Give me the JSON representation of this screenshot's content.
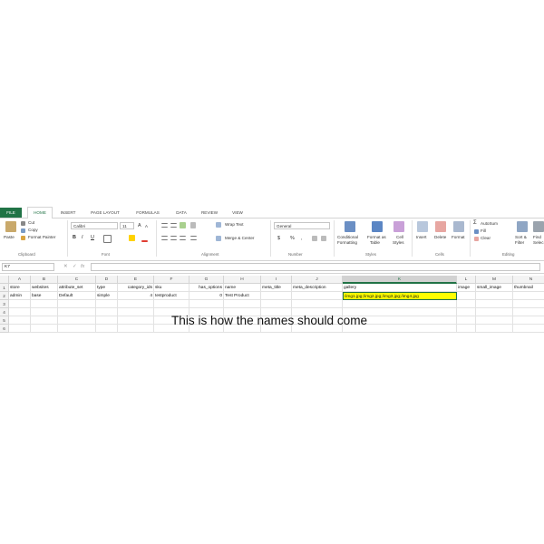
{
  "tabs": [
    "FILE",
    "HOME",
    "INSERT",
    "PAGE LAYOUT",
    "FORMULAS",
    "DATA",
    "REVIEW",
    "VIEW"
  ],
  "ribbon": {
    "clipboard": {
      "paste": "Paste",
      "cut": "Cut",
      "copy": "Copy",
      "format_painter": "Format Painter",
      "label": "Clipboard"
    },
    "font": {
      "name": "Calibri",
      "size": "11",
      "bold": "B",
      "italic": "I",
      "underline": "U",
      "grow": "A",
      "shrink": "A",
      "label": "Font"
    },
    "alignment": {
      "wrap": "Wrap Text",
      "merge": "Merge & Center",
      "label": "Alignment"
    },
    "number": {
      "format": "General",
      "currency": "$",
      "percent": "%",
      "comma": ",",
      "label": "Number"
    },
    "styles": {
      "conditional1": "Conditional",
      "conditional2": "Formatting",
      "table1": "Format as",
      "table2": "Table",
      "cell1": "Cell",
      "cell2": "Styles",
      "label": "Styles"
    },
    "cells": {
      "insert": "Insert",
      "delete": "Delete",
      "format": "Format",
      "label": "Cells"
    },
    "editing": {
      "autosum": "AutoSum",
      "fill": "Fill",
      "clear": "Clear",
      "sort1": "Sort &",
      "sort2": "Filter",
      "find1": "Find",
      "find2": "Selec",
      "label": "Editing"
    }
  },
  "formula_bar": {
    "name_box": "K7",
    "cancel": "✕",
    "enter": "✓",
    "fx": "fx"
  },
  "columns": [
    "A",
    "B",
    "C",
    "D",
    "E",
    "F",
    "G",
    "H",
    "I",
    "J",
    "K",
    "L",
    "M",
    "N"
  ],
  "rows": [
    "1",
    "2",
    "3",
    "4",
    "5",
    "6"
  ],
  "cells": {
    "row1": [
      "store",
      "websites",
      "attribute_set",
      "type",
      "category_ids",
      "sku",
      "has_options",
      "name",
      "meta_title",
      "meta_description",
      "gallery",
      "image",
      "small_image",
      "thumbnail"
    ],
    "row2": [
      "admin",
      "base",
      "Default",
      "simple",
      "4",
      "testproduct",
      "0",
      "Test Product",
      "",
      "",
      "/img1.jpg;/img2.jpg;/img3.jpg;/img4.jpg",
      "",
      "",
      ""
    ]
  },
  "annotation": "This is how the names should come",
  "colors": {
    "accent": "#217346",
    "highlight": "#ffff00"
  }
}
